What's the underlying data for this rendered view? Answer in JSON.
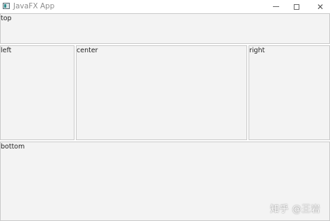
{
  "window": {
    "title": "JavaFX App",
    "controls": {
      "minimize": "minimize-icon",
      "maximize": "maximize-icon",
      "close": "close-icon",
      "close_glyph": "✕"
    }
  },
  "panes": {
    "top": "top",
    "left": "left",
    "center": "center",
    "right": "right",
    "bottom": "bottom"
  },
  "watermark": "知乎 @王岩",
  "colors": {
    "pane_background": "#f3f3f3",
    "pane_border": "#c9c9c9",
    "titlebar": "#ffffff"
  }
}
